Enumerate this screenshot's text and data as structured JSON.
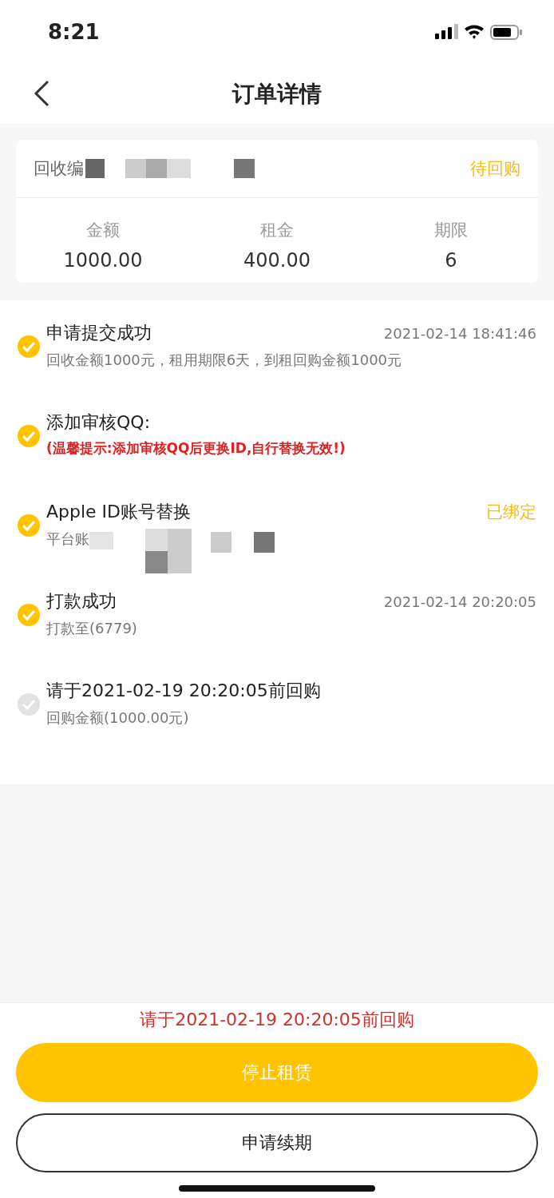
{
  "status_bar": {
    "time": "8:21"
  },
  "nav": {
    "title": "订单详情"
  },
  "order": {
    "number_label": "回收编",
    "status": "待回购",
    "stats": [
      {
        "label": "金额",
        "value": "1000.00"
      },
      {
        "label": "租金",
        "value": "400.00"
      },
      {
        "label": "期限",
        "value": "6"
      }
    ]
  },
  "steps": [
    {
      "title": "申请提交成功",
      "time": "2021-02-14 18:41:46",
      "detail": "回收金额1000元，租用期限6天，到租回购金额1000元",
      "done": true
    },
    {
      "title": "添加审核QQ:",
      "note": "(温馨提示:添加审核QQ后更换ID,自行替换无效!)",
      "done": true
    },
    {
      "title": "Apple ID账号替换",
      "status": "已绑定",
      "detail": "平台账",
      "redacted": true,
      "done": true
    },
    {
      "title": "打款成功",
      "time": "2021-02-14 20:20:05",
      "detail": "打款至(6779)",
      "done": true
    },
    {
      "title": "请于2021-02-19 20:20:05前回购",
      "detail": "回购金额(1000.00元)",
      "done": false
    }
  ],
  "footer": {
    "notice": "请于2021-02-19 20:20:05前回购",
    "primary_button": "停止租赁",
    "secondary_button": "申请续期"
  }
}
